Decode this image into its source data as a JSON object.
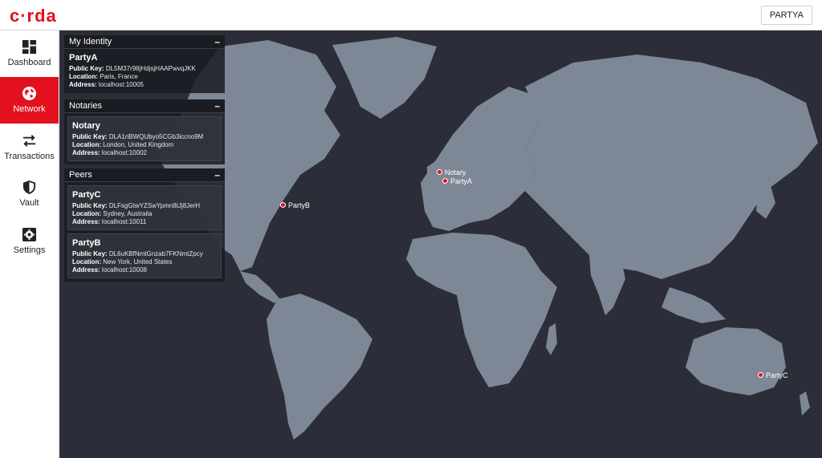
{
  "app": {
    "logo": "c·rda",
    "user_button": "PARTYA"
  },
  "sidebar": {
    "items": [
      {
        "label": "Dashboard",
        "icon": "dashboard-icon",
        "active": false
      },
      {
        "label": "Network",
        "icon": "globe-icon",
        "active": true
      },
      {
        "label": "Transactions",
        "icon": "transfer-arrows-icon",
        "active": false
      },
      {
        "label": "Vault",
        "icon": "shield-icon",
        "active": false
      },
      {
        "label": "Settings",
        "icon": "gear-icon",
        "active": false
      }
    ]
  },
  "panels": {
    "identity": {
      "title": "My Identity",
      "collapse": "–",
      "node": {
        "name": "PartyA",
        "key_label": "Public Key:",
        "key": "DL5M37r98jHdjsjHAAPwvqJKK",
        "loc_label": "Location:",
        "location": "Paris, France",
        "addr_label": "Address:",
        "address": "localhost:10005"
      }
    },
    "notaries": {
      "title": "Notaries",
      "collapse": "–",
      "node": {
        "name": "Notary",
        "key_label": "Public Key:",
        "key": "DLA1riBWQUbyo5CGb3iccno9M",
        "loc_label": "Location:",
        "location": "London, United Kingdom",
        "addr_label": "Address:",
        "address": "localhost:10002"
      }
    },
    "peers": {
      "title": "Peers",
      "collapse": "–",
      "nodes": [
        {
          "name": "PartyC",
          "key_label": "Public Key:",
          "key": "DLFsgGtwYZSwYpmn8tJj8JerH",
          "loc_label": "Location:",
          "location": "Sydney, Australia",
          "addr_label": "Address:",
          "address": "localhost:10011"
        },
        {
          "name": "PartyB",
          "key_label": "Public Key:",
          "key": "DL6uKBfNmtGnzab7FKNmtZpcy",
          "loc_label": "Location:",
          "location": "New York, United States",
          "addr_label": "Address:",
          "address": "localhost:10008"
        }
      ]
    }
  },
  "map": {
    "background": "#2b2e38",
    "land": "#7d8796",
    "marker_color": "#e3101e",
    "markers": [
      {
        "label": "Notary"
      },
      {
        "label": "PartyA"
      },
      {
        "label": "PartyB"
      },
      {
        "label": "PartyC"
      }
    ]
  }
}
